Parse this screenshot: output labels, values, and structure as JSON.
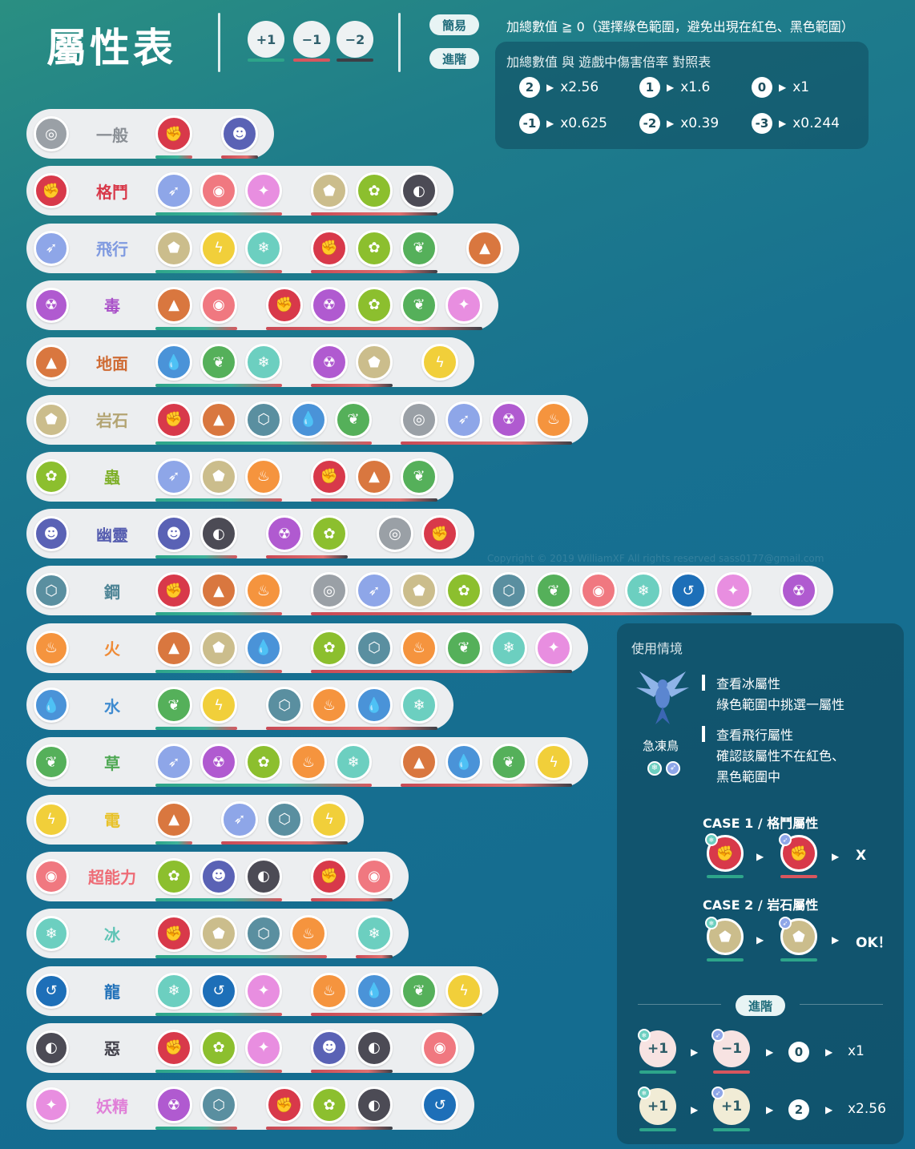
{
  "header": {
    "title": "屬性表",
    "legend": [
      "+1",
      "−1",
      "−2"
    ],
    "pill_simple": "簡易",
    "pill_advanced": "進階",
    "simple_rule": "加總數值 ≧ 0（選擇綠色範圍，避免出現在紅色、黑色範圍）",
    "mult_title": "加總數值 與 遊戲中傷害倍率 對照表",
    "multipliers": [
      {
        "n": "2",
        "v": "x2.56"
      },
      {
        "n": "1",
        "v": "x1.6"
      },
      {
        "n": "0",
        "v": "x1"
      },
      {
        "n": "-1",
        "v": "x0.625"
      },
      {
        "n": "-2",
        "v": "x0.39"
      },
      {
        "n": "-3",
        "v": "x0.244"
      }
    ]
  },
  "colors": {
    "normal": "#9aa0a6",
    "fighting": "#d8394a",
    "flying": "#8ea6e8",
    "poison": "#b05ad0",
    "ground": "#d9773f",
    "rock": "#cbbd8c",
    "bug": "#8cbf2e",
    "ghost": "#5a62b5",
    "steel": "#5a8fa0",
    "fire": "#f5943e",
    "water": "#4a93d8",
    "grass": "#55b05a",
    "electric": "#f1cf3a",
    "psychic": "#f07880",
    "ice": "#6ccfc0",
    "dragon": "#1d6fb8",
    "dark": "#4c4b55",
    "fairy": "#e88ee0"
  },
  "types": [
    {
      "key": "normal",
      "label": "一般",
      "good": [
        "fighting"
      ],
      "bad": [
        "ghost"
      ]
    },
    {
      "key": "fighting",
      "label": "格鬥",
      "good": [
        "flying",
        "psychic",
        "fairy"
      ],
      "bad": [
        "rock",
        "bug",
        "dark"
      ]
    },
    {
      "key": "flying",
      "label": "飛行",
      "good": [
        "rock",
        "electric",
        "ice"
      ],
      "bad": [
        "fighting",
        "bug",
        "grass"
      ],
      "worst": [
        "ground"
      ]
    },
    {
      "key": "poison",
      "label": "毒",
      "good": [
        "ground",
        "psychic"
      ],
      "bad": [
        "fighting",
        "poison",
        "bug",
        "grass",
        "fairy"
      ]
    },
    {
      "key": "ground",
      "label": "地面",
      "good": [
        "water",
        "grass",
        "ice"
      ],
      "bad": [
        "poison",
        "rock"
      ],
      "worst": [
        "electric"
      ]
    },
    {
      "key": "rock",
      "label": "岩石",
      "good": [
        "fighting",
        "ground",
        "steel",
        "water",
        "grass"
      ],
      "bad": [
        "normal",
        "flying",
        "poison",
        "fire"
      ]
    },
    {
      "key": "bug",
      "label": "蟲",
      "good": [
        "flying",
        "rock",
        "fire"
      ],
      "bad": [
        "fighting",
        "ground",
        "grass"
      ]
    },
    {
      "key": "ghost",
      "label": "幽靈",
      "good": [
        "ghost",
        "dark"
      ],
      "bad": [
        "poison",
        "bug"
      ],
      "worst": [
        "normal",
        "fighting"
      ]
    },
    {
      "key": "steel",
      "label": "鋼",
      "good": [
        "fighting",
        "ground",
        "fire"
      ],
      "bad": [
        "normal",
        "flying",
        "rock",
        "bug",
        "steel",
        "grass",
        "psychic",
        "ice",
        "dragon",
        "fairy"
      ],
      "worst": [
        "poison"
      ]
    },
    {
      "key": "fire",
      "label": "火",
      "good": [
        "ground",
        "rock",
        "water"
      ],
      "bad": [
        "bug",
        "steel",
        "fire",
        "grass",
        "ice",
        "fairy"
      ]
    },
    {
      "key": "water",
      "label": "水",
      "good": [
        "grass",
        "electric"
      ],
      "bad": [
        "steel",
        "fire",
        "water",
        "ice"
      ]
    },
    {
      "key": "grass",
      "label": "草",
      "good": [
        "flying",
        "poison",
        "bug",
        "fire",
        "ice"
      ],
      "bad": [
        "ground",
        "water",
        "grass",
        "electric"
      ]
    },
    {
      "key": "electric",
      "label": "電",
      "good": [
        "ground"
      ],
      "bad": [
        "flying",
        "steel",
        "electric"
      ]
    },
    {
      "key": "psychic",
      "label": "超能力",
      "good": [
        "bug",
        "ghost",
        "dark"
      ],
      "bad": [
        "fighting",
        "psychic"
      ]
    },
    {
      "key": "ice",
      "label": "冰",
      "good": [
        "fighting",
        "rock",
        "steel",
        "fire"
      ],
      "bad": [
        "ice"
      ]
    },
    {
      "key": "dragon",
      "label": "龍",
      "good": [
        "ice",
        "dragon",
        "fairy"
      ],
      "bad": [
        "fire",
        "water",
        "grass",
        "electric"
      ]
    },
    {
      "key": "dark",
      "label": "惡",
      "good": [
        "fighting",
        "bug",
        "fairy"
      ],
      "bad": [
        "ghost",
        "dark"
      ],
      "worst": [
        "psychic"
      ]
    },
    {
      "key": "fairy",
      "label": "妖精",
      "good": [
        "poison",
        "steel"
      ],
      "bad": [
        "fighting",
        "bug",
        "dark"
      ],
      "worst": [
        "dragon"
      ]
    }
  ],
  "panel": {
    "title": "使用情境",
    "pokemon": "急凍鳥",
    "step1a": "查看冰屬性",
    "step1b": "綠色範圍中挑選一屬性",
    "step2a": "查看飛行屬性",
    "step2b": "確認該屬性不在紅色、",
    "step2c": "黑色範圍中",
    "case1": "CASE 1 / 格鬥屬性",
    "case1_result": "X",
    "case2": "CASE 2 / 岩石屬性",
    "case2_result": "OK！",
    "advanced": "進階",
    "adv1": {
      "a": "+1",
      "b": "−1",
      "sum": "0",
      "mult": "x1"
    },
    "adv2": {
      "a": "+1",
      "b": "+1",
      "sum": "2",
      "mult": "x2.56"
    }
  },
  "watermark": "Copyright © 2019 WilliamXF All rights reserved sass0177@gmail.com"
}
